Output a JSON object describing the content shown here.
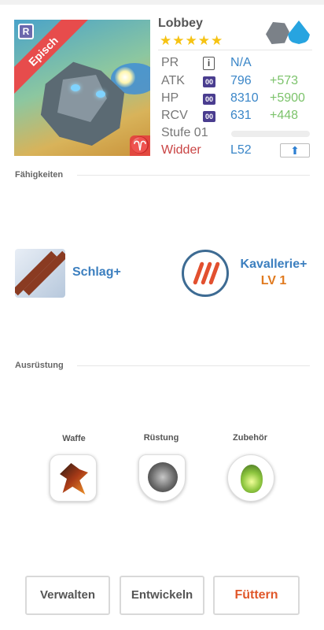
{
  "hero": {
    "name": "Lobbey",
    "stars": "★★★★★",
    "rarity": "Episch",
    "rarity_badge": "R",
    "zodiac_glyph": "♈",
    "elements": [
      "rock-icon",
      "water-drop-icon"
    ]
  },
  "stats": {
    "pr": {
      "label": "PR",
      "info": "i",
      "value": "N/A"
    },
    "atk": {
      "label": "ATK",
      "tag": "00",
      "value": "796",
      "bonus": "+573"
    },
    "hp": {
      "label": "HP",
      "tag": "00",
      "value": "8310",
      "bonus": "+5900"
    },
    "rcv": {
      "label": "RCV",
      "tag": "00",
      "value": "631",
      "bonus": "+448"
    },
    "stufe": {
      "label": "Stufe 01",
      "progress": 0
    },
    "sign": {
      "label": "Widder",
      "value": "L52",
      "upgrade_icon": "⬆"
    }
  },
  "sections": {
    "skills_title": "Fähigkeiten",
    "equipment_title": "Ausrüstung"
  },
  "skills": [
    {
      "name": "Schlag+",
      "icon": "arrows-strike-icon"
    },
    {
      "name": "Kavallerie+",
      "level": "LV 1",
      "icon": "claw-icon"
    }
  ],
  "equipment": [
    {
      "label": "Waffe",
      "icon": "weapon-icon"
    },
    {
      "label": "Rüstung",
      "icon": "armor-icon"
    },
    {
      "label": "Zubehör",
      "icon": "accessory-icon"
    }
  ],
  "buttons": {
    "manage": "Verwalten",
    "evolve": "Entwickeln",
    "feed": "Füttern"
  },
  "colors": {
    "value_blue": "#3a86c8",
    "bonus_green": "#7cc36b",
    "sign_red": "#c94444",
    "feed_orange": "#e0572a",
    "star_gold": "#f6c313"
  }
}
